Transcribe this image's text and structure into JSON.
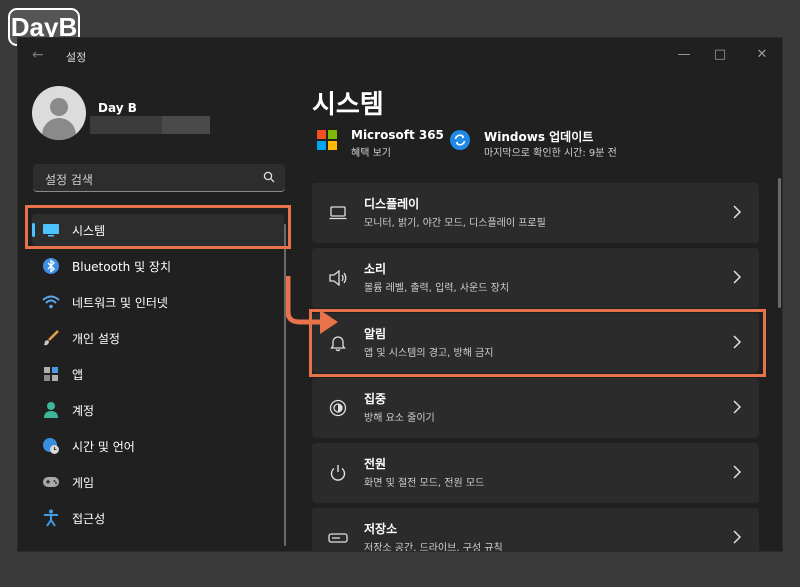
{
  "watermark": "DayB",
  "window": {
    "title": "설정"
  },
  "user": {
    "name": "Day B"
  },
  "search": {
    "placeholder": "설정 검색"
  },
  "nav": [
    {
      "label": "시스템",
      "icon": "monitor-icon"
    },
    {
      "label": "Bluetooth 및 장치",
      "icon": "bluetooth-icon"
    },
    {
      "label": "네트워크 및 인터넷",
      "icon": "wifi-icon"
    },
    {
      "label": "개인 설정",
      "icon": "brush-icon"
    },
    {
      "label": "앱",
      "icon": "apps-icon"
    },
    {
      "label": "계정",
      "icon": "person-icon"
    },
    {
      "label": "시간 및 언어",
      "icon": "globe-clock-icon"
    },
    {
      "label": "게임",
      "icon": "gamepad-icon"
    },
    {
      "label": "접근성",
      "icon": "accessibility-icon"
    }
  ],
  "main": {
    "title": "시스템",
    "quick": [
      {
        "title": "Microsoft 365",
        "sub": "혜택 보기",
        "icon": "microsoft-logo-icon"
      },
      {
        "title": "Windows 업데이트",
        "sub": "마지막으로 확인한 시간: 9분 전",
        "icon": "windows-update-icon"
      }
    ],
    "cards": [
      {
        "title": "디스플레이",
        "sub": "모니터, 밝기, 야간 모드, 디스플레이 프로필",
        "icon": "display-icon"
      },
      {
        "title": "소리",
        "sub": "볼륨 레벨, 출력, 입력, 사운드 장치",
        "icon": "speaker-icon"
      },
      {
        "title": "알림",
        "sub": "앱 및 시스템의 경고, 방해 금지",
        "icon": "bell-icon"
      },
      {
        "title": "집중",
        "sub": "방해 요소 줄이기",
        "icon": "focus-icon"
      },
      {
        "title": "전원",
        "sub": "화면 및 절전 모드, 전원 모드",
        "icon": "power-icon"
      },
      {
        "title": "저장소",
        "sub": "저장소 공간, 드라이브, 구성 규칙",
        "icon": "storage-icon"
      }
    ]
  },
  "colors": {
    "accent": "#4cc2ff",
    "highlight": "#e8734a",
    "background": "#202020",
    "card": "#2b2b2b"
  }
}
